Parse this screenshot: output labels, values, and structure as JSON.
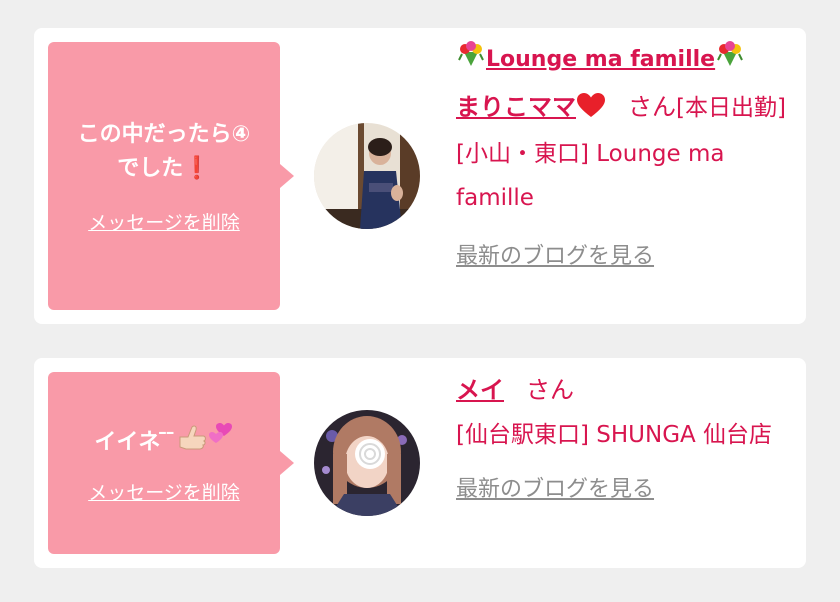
{
  "cards": [
    {
      "message_line1": "この中だったら④",
      "message_line2": "でした",
      "delete_label": "メッセージを削除",
      "shop_name": "Lounge ma famille",
      "girl_name": "まりこママ",
      "san": "さん",
      "status": "[本日出勤]",
      "area_shop": "[小山・東口] Lounge ma famille",
      "blog_label": "最新のブログを見る"
    },
    {
      "message": "イイネ ̄ ̄",
      "delete_label": "メッセージを削除",
      "girl_name": "メイ",
      "san": "さん",
      "area_shop": "[仙台駅東口] SHUNGA 仙台店",
      "blog_label": "最新のブログを見る"
    }
  ],
  "colors": {
    "accent": "#d8154f",
    "bubble": "#f99aa8",
    "link_gray": "#8d8d8d",
    "background": "#efefef"
  },
  "icons": [
    "flower-bouquet-icon",
    "red-heart-icon",
    "exclamation-icon",
    "thumb-hand-icon",
    "pink-hearts-icon"
  ]
}
